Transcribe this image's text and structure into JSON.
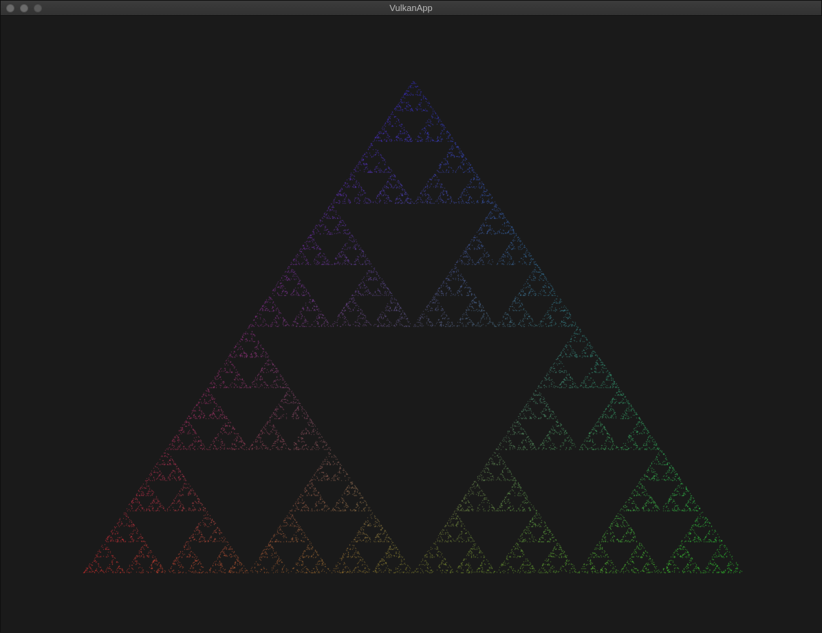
{
  "window": {
    "title": "VulkanApp",
    "controls": [
      {
        "name": "close",
        "icon": "close-icon"
      },
      {
        "name": "minimize",
        "icon": "minimize-icon"
      },
      {
        "name": "zoom",
        "icon": "zoom-icon"
      }
    ]
  },
  "render": {
    "content": "sierpinski-triangle",
    "background_color": "#1a1a1a",
    "vertex_colors": {
      "top": "#2a1fe0",
      "bottom_left": "#e01f1f",
      "bottom_right": "#1fe01f"
    }
  }
}
